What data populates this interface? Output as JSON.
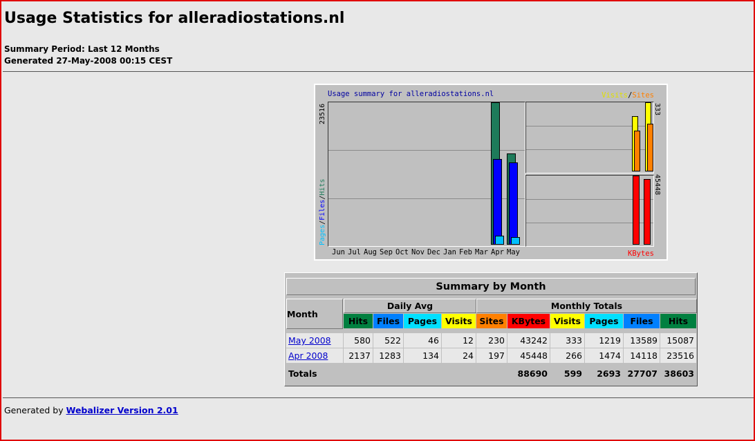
{
  "page": {
    "title": "Usage Statistics for alleradiostations.nl",
    "summary_period": "Summary Period: Last 12 Months",
    "generated": "Generated 27-May-2008 00:15 CEST"
  },
  "chart_data": {
    "type": "bar",
    "title": "Usage summary for alleradiostations.nl",
    "categories": [
      "Jun",
      "Jul",
      "Aug",
      "Sep",
      "Oct",
      "Nov",
      "Dec",
      "Jan",
      "Feb",
      "Mar",
      "Apr",
      "May"
    ],
    "left_panel": {
      "ylabel_parts": [
        "Pages",
        "Files",
        "Hits"
      ],
      "max_label": "23516",
      "ymax": 23516,
      "series": [
        {
          "name": "Hits",
          "color": "#1e7b5a",
          "values": [
            0,
            0,
            0,
            0,
            0,
            0,
            0,
            0,
            0,
            0,
            23516,
            15087
          ]
        },
        {
          "name": "Files",
          "color": "#0000ff",
          "values": [
            0,
            0,
            0,
            0,
            0,
            0,
            0,
            0,
            0,
            0,
            14118,
            13589
          ]
        },
        {
          "name": "Pages",
          "color": "#00c0ff",
          "values": [
            0,
            0,
            0,
            0,
            0,
            0,
            0,
            0,
            0,
            0,
            1474,
            1219
          ]
        }
      ]
    },
    "right_top_panel": {
      "legend_parts": [
        "Visits",
        "Sites"
      ],
      "max_label": "333",
      "ymax": 333,
      "series": [
        {
          "name": "Visits",
          "color": "#ffff00",
          "values": [
            266,
            333
          ]
        },
        {
          "name": "Sites",
          "color": "#ff8000",
          "values": [
            197,
            230
          ]
        }
      ]
    },
    "right_bottom_panel": {
      "label": "KBytes",
      "max_label": "45448",
      "ymax": 45448,
      "series": [
        {
          "name": "KBytes",
          "color": "#ff0000",
          "values": [
            45448,
            43242
          ]
        }
      ]
    }
  },
  "table": {
    "title": "Summary by Month",
    "month_header": "Month",
    "daily_avg_header": "Daily Avg",
    "monthly_totals_header": "Monthly Totals",
    "daily_cols": [
      {
        "label": "Hits",
        "color": "#008040"
      },
      {
        "label": "Files",
        "color": "#0080ff"
      },
      {
        "label": "Pages",
        "color": "#00e0ff"
      },
      {
        "label": "Visits",
        "color": "#ffff00"
      }
    ],
    "monthly_cols": [
      {
        "label": "Sites",
        "color": "#ff8000"
      },
      {
        "label": "KBytes",
        "color": "#ff0000"
      },
      {
        "label": "Visits",
        "color": "#ffff00"
      },
      {
        "label": "Pages",
        "color": "#00e0ff"
      },
      {
        "label": "Files",
        "color": "#0080ff"
      },
      {
        "label": "Hits",
        "color": "#008040"
      }
    ],
    "rows": [
      {
        "month": "May 2008",
        "values": [
          "580",
          "522",
          "46",
          "12",
          "230",
          "43242",
          "333",
          "1219",
          "13589",
          "15087"
        ]
      },
      {
        "month": "Apr 2008",
        "values": [
          "2137",
          "1283",
          "134",
          "24",
          "197",
          "45448",
          "266",
          "1474",
          "14118",
          "23516"
        ]
      }
    ],
    "totals_label": "Totals",
    "totals": [
      "88690",
      "599",
      "2693",
      "27707",
      "38603"
    ]
  },
  "footer": {
    "prefix": "Generated by",
    "link": "Webalizer Version 2.01"
  }
}
